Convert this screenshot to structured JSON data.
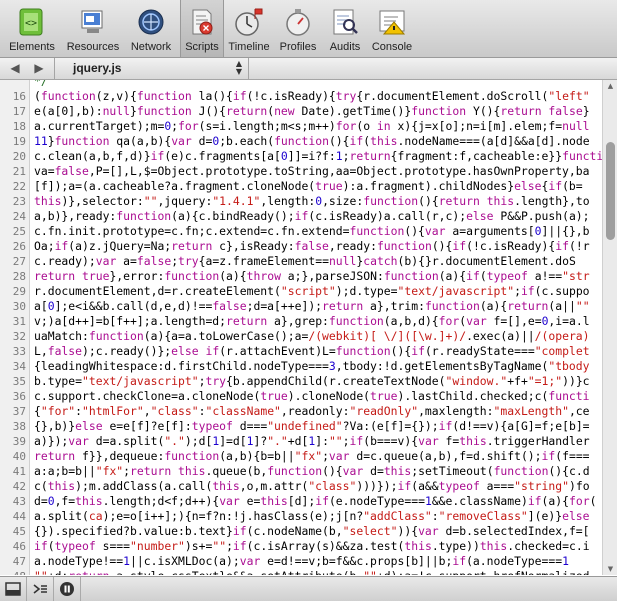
{
  "toolbar": {
    "items": [
      {
        "label": "Elements"
      },
      {
        "label": "Resources"
      },
      {
        "label": "Network"
      },
      {
        "label": "Scripts"
      },
      {
        "label": "Timeline"
      },
      {
        "label": "Profiles"
      },
      {
        "label": "Audits"
      },
      {
        "label": "Console"
      }
    ]
  },
  "filebar": {
    "back": "◀",
    "forward": "▶",
    "file": "jquery.js"
  },
  "code": {
    "lines": [
      {
        "n": "",
        "h": "<span class='c'>*/</span>"
      },
      {
        "n": "16",
        "h": "(<span class='k'>function</span>(z,v){<span class='k'>function</span> la(){<span class='k'>if</span>(!c.isReady){<span class='k'>try</span>{r.documentElement.doScroll(<span class='s'>\"left\"</span>"
      },
      {
        "n": "17",
        "h": "e(a[0],b):<span class='k'>null</span>}<span class='k'>function</span> J(){<span class='k'>return</span>(<span class='k'>new</span> Date).getTime()}<span class='k'>function</span> Y(){<span class='k'>return</span> <span class='k'>false</span>}"
      },
      {
        "n": "18",
        "h": "a.currentTarget);m=<span class='n'>0</span>;<span class='k'>for</span>(s=i.length;m&lt;s;m++)<span class='k'>for</span>(o <span class='k'>in</span> x){j=x[o];n=i[m].elem;f=<span class='k'>null</span>"
      },
      {
        "n": "19",
        "h": "<span class='n'>11</span>}<span class='k'>function</span> qa(a,b){<span class='k'>var</span> d=<span class='n'>0</span>;b.each(<span class='k'>function</span>(){<span class='k'>if</span>(<span class='k'>this</span>.nodeName===(a[d]&amp;&amp;a[d].node"
      },
      {
        "n": "20",
        "h": "c.clean(a,b,f,d)}<span class='k'>if</span>(e)c.fragments[a[<span class='n'>0</span>]]=i?f:<span class='n'>1</span>;<span class='k'>return</span>{fragment:f,cacheable:e}}<span class='k'>function</span>"
      },
      {
        "n": "21",
        "h": "va=<span class='k'>false</span>,P=[],L,$=Object.prototype.toString,aa=Object.prototype.hasOwnProperty,ba"
      },
      {
        "n": "22",
        "h": "[f]);a=(a.cacheable?a.fragment.cloneNode(<span class='k'>true</span>):a.fragment).childNodes}<span class='k'>else</span>{<span class='k'>if</span>(b="
      },
      {
        "n": "23",
        "h": "<span class='k'>this</span>)},selector:<span class='s'>\"\"</span>,jquery:<span class='s'>\"1.4.1\"</span>,length:<span class='n'>0</span>,size:<span class='k'>function</span>(){<span class='k'>return</span> <span class='k'>this</span>.length},to"
      },
      {
        "n": "24",
        "h": "a,b)},ready:<span class='k'>function</span>(a){c.bindReady();<span class='k'>if</span>(c.isReady)a.call(r,c);<span class='k'>else</span> P&amp;&amp;P.push(a);"
      },
      {
        "n": "25",
        "h": "c.fn.init.prototype=c.fn;c.extend=c.fn.extend=<span class='k'>function</span>(){<span class='k'>var</span> a=arguments[<span class='n'>0</span>]||{},b"
      },
      {
        "n": "26",
        "h": "Oa;<span class='k'>if</span>(a)z.jQuery=Na;<span class='k'>return</span> c},isReady:<span class='k'>false</span>,ready:<span class='k'>function</span>(){<span class='k'>if</span>(!c.isReady){<span class='k'>if</span>(!r"
      },
      {
        "n": "27",
        "h": "c.ready);<span class='k'>var</span> a=<span class='k'>false</span>;<span class='k'>try</span>{a=z.frameElement==<span class='k'>null</span>}<span class='k'>catch</span>(b){}r.documentElement.doS"
      },
      {
        "n": "28",
        "h": "<span class='k'>return</span> <span class='k'>true</span>},error:<span class='k'>function</span>(a){<span class='k'>throw</span> a;},parseJSON:<span class='k'>function</span>(a){<span class='k'>if</span>(<span class='k'>typeof</span> a!==<span class='s'>\"str</span>"
      },
      {
        "n": "29",
        "h": "r.documentElement,d=r.createElement(<span class='s'>\"script\"</span>);d.type=<span class='s'>\"text/javascript\"</span>;<span class='k'>if</span>(c.suppo"
      },
      {
        "n": "30",
        "h": "a[<span class='n'>0</span>];e&lt;i&amp;&amp;b.call(d,e,d)!==<span class='k'>false</span>;d=a[++e]);<span class='k'>return</span> a},trim:<span class='k'>function</span>(a){<span class='k'>return</span>(a||<span class='s'>\"\"</span>"
      },
      {
        "n": "31",
        "h": "v;)a[d++]=b[f++];a.length=d;<span class='k'>return</span> a},grep:<span class='k'>function</span>(a,b,d){<span class='k'>for</span>(<span class='k'>var</span> f=[],e=<span class='n'>0</span>,i=a.l"
      },
      {
        "n": "32",
        "h": "uaMatch:<span class='k'>function</span>(a){a=a.toLowerCase();a=<span class='s'>/(webkit)[ \\/]([\\w.]+)/</span>.exec(a)||<span class='s'>/(opera)</span>"
      },
      {
        "n": "33",
        "h": "L,<span class='k'>false</span>);c.ready()};<span class='k'>else</span> <span class='k'>if</span>(r.attachEvent)L=<span class='k'>function</span>(){<span class='k'>if</span>(r.readyState===<span class='s'>\"complet</span>"
      },
      {
        "n": "34",
        "h": "{leadingWhitespace:d.firstChild.nodeType===<span class='n'>3</span>,tbody:!d.getElementsByTagName(<span class='s'>\"tbody</span>"
      },
      {
        "n": "35",
        "h": "b.type=<span class='s'>\"text/javascript\"</span>;<span class='k'>try</span>{b.appendChild(r.createTextNode(<span class='s'>\"window.\"</span>+f+<span class='s'>\"=1;\"</span>))}c"
      },
      {
        "n": "36",
        "h": "c.support.checkClone=a.cloneNode(<span class='k'>true</span>).cloneNode(<span class='k'>true</span>).lastChild.checked;c(<span class='k'>functi</span>"
      },
      {
        "n": "37",
        "h": "{<span class='s'>\"for\"</span>:<span class='s'>\"htmlFor\"</span>,<span class='s'>\"class\"</span>:<span class='s'>\"className\"</span>,readonly:<span class='s'>\"readOnly\"</span>,maxlength:<span class='s'>\"maxLength\"</span>,ce"
      },
      {
        "n": "38",
        "h": "{},b)}<span class='k'>else</span> e=e[f]?e[f]:<span class='k'>typeof</span> d===<span class='s'>\"undefined\"</span>?Va:(e[f]={});<span class='k'>if</span>(d!==v){a[G]=f;e[b]="
      },
      {
        "n": "39",
        "h": "a)});<span class='k'>var</span> d=a.split(<span class='s'>\".\"</span>);d[<span class='n'>1</span>]=d[<span class='n'>1</span>]?<span class='s'>\".\"</span>+d[<span class='n'>1</span>]:<span class='s'>\"\"</span>;<span class='k'>if</span>(b===v){<span class='k'>var</span> f=<span class='k'>this</span>.triggerHandler"
      },
      {
        "n": "40",
        "h": "<span class='k'>return</span> f}},dequeue:<span class='k'>function</span>(a,b){b=b||<span class='s'>\"fx\"</span>;<span class='k'>var</span> d=c.queue(a,b),f=d.shift();<span class='k'>if</span>(f==="
      },
      {
        "n": "41",
        "h": "a:a;b=b||<span class='s'>\"fx\"</span>;<span class='k'>return</span> <span class='k'>this</span>.queue(b,<span class='k'>function</span>(){<span class='k'>var</span> d=<span class='k'>this</span>;setTimeout(<span class='k'>function</span>(){c.d"
      },
      {
        "n": "42",
        "h": "c(<span class='k'>this</span>);m.addClass(a.call(<span class='k'>this</span>,o,m.attr(<span class='s'>\"class\"</span>)))});<span class='k'>if</span>(a&amp;&amp;<span class='k'>typeof</span> a===<span class='s'>\"string\"</span>)fo"
      },
      {
        "n": "43",
        "h": "d=<span class='n'>0</span>,f=<span class='k'>this</span>.length;d&lt;f;d++){<span class='k'>var</span> e=<span class='k'>this</span>[d];<span class='k'>if</span>(e.nodeType===<span class='n'>1</span>&amp;&amp;e.className)<span class='k'>if</span>(a){<span class='k'>for</span>("
      },
      {
        "n": "44",
        "h": "a.split(<span class='s'>ca</span>);e=o[i++];){n=f?n:!j.hasClass(e);j[n?<span class='s'>\"addClass\"</span>:<span class='s'>\"removeClass\"</span>](e)}<span class='k'>else</span>"
      },
      {
        "n": "45",
        "h": "{}).specified?b.value:b.text}<span class='k'>if</span>(c.nodeName(b,<span class='s'>\"select\"</span>)){<span class='k'>var</span> d=b.selectedIndex,f=["
      },
      {
        "n": "46",
        "h": "<span class='k'>if</span>(<span class='k'>typeof</span> s===<span class='s'>\"number\"</span>)s+=<span class='s'>\"\"</span>;<span class='k'>if</span>(c.isArray(s)&amp;&amp;za.test(<span class='k'>this</span>.type))<span class='k'>this</span>.checked=c.i"
      },
      {
        "n": "47",
        "h": "a.nodeType!==<span class='n'>1</span>||c.isXMLDoc(a);<span class='k'>var</span> e=d!==v;b=f&amp;&amp;c.props[b]||b;<span class='k'>if</span>(a.nodeType===<span class='n'>1</span>"
      },
      {
        "n": "48",
        "h": "<span class='s'>\"\"</span>+d;<span class='k'>return</span> a.style.cssText}e&amp;&amp;a.setAttribute(b,<span class='s'>\"\"</span>+d);a=!c.support.hrefNormalized"
      },
      {
        "n": "49",
        "h": "a.replace(<span class='s'>/\\. /</span>,<span class='s'>\"\"</span>)+<span class='s'>\"\"</span>;<span class='k'>return</span> <span class='k'>typeof</span> a===<span class='s'>\"undefined\"</span>?<span class='k'>null</span>:a.event.triggered"
      }
    ]
  },
  "status": {
    "buttons": [
      {
        "name": "dock-icon"
      },
      {
        "name": "console-icon"
      },
      {
        "name": "pause-icon"
      }
    ]
  }
}
